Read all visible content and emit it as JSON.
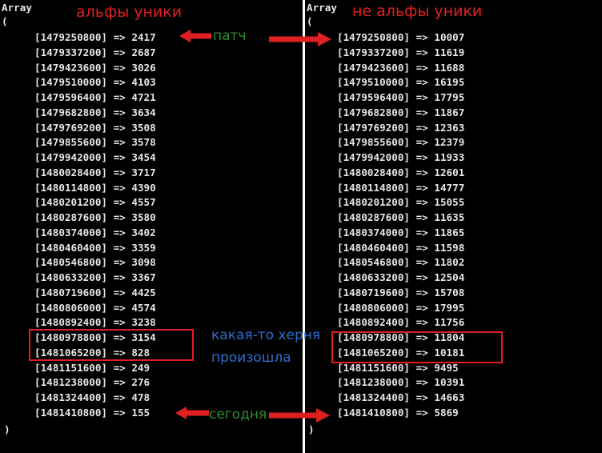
{
  "left": {
    "header": "Array",
    "open_paren": "(",
    "close_paren": ")",
    "title": "альфы уники",
    "rows": [
      {
        "key": "[1479250800]",
        "arrow": "=>",
        "value": "2417"
      },
      {
        "key": "[1479337200]",
        "arrow": "=>",
        "value": "2687"
      },
      {
        "key": "[1479423600]",
        "arrow": "=>",
        "value": "3026"
      },
      {
        "key": "[1479510000]",
        "arrow": "=>",
        "value": "4103"
      },
      {
        "key": "[1479596400]",
        "arrow": "=>",
        "value": "4721"
      },
      {
        "key": "[1479682800]",
        "arrow": "=>",
        "value": "3634"
      },
      {
        "key": "[1479769200]",
        "arrow": "=>",
        "value": "3508"
      },
      {
        "key": "[1479855600]",
        "arrow": "=>",
        "value": "3578"
      },
      {
        "key": "[1479942000]",
        "arrow": "=>",
        "value": "3454"
      },
      {
        "key": "[1480028400]",
        "arrow": "=>",
        "value": "3717"
      },
      {
        "key": "[1480114800]",
        "arrow": "=>",
        "value": "4390"
      },
      {
        "key": "[1480201200]",
        "arrow": "=>",
        "value": "4557"
      },
      {
        "key": "[1480287600]",
        "arrow": "=>",
        "value": "3580"
      },
      {
        "key": "[1480374000]",
        "arrow": "=>",
        "value": "3402"
      },
      {
        "key": "[1480460400]",
        "arrow": "=>",
        "value": "3359"
      },
      {
        "key": "[1480546800]",
        "arrow": "=>",
        "value": "3098"
      },
      {
        "key": "[1480633200]",
        "arrow": "=>",
        "value": "3367"
      },
      {
        "key": "[1480719600]",
        "arrow": "=>",
        "value": "4425"
      },
      {
        "key": "[1480806000]",
        "arrow": "=>",
        "value": "4574"
      },
      {
        "key": "[1480892400]",
        "arrow": "=>",
        "value": "3238"
      },
      {
        "key": "[1480978800]",
        "arrow": "=>",
        "value": "3154"
      },
      {
        "key": "[1481065200]",
        "arrow": "=>",
        "value": "828"
      },
      {
        "key": "[1481151600]",
        "arrow": "=>",
        "value": "249"
      },
      {
        "key": "[1481238000]",
        "arrow": "=>",
        "value": "276"
      },
      {
        "key": "[1481324400]",
        "arrow": "=>",
        "value": "478"
      },
      {
        "key": "[1481410800]",
        "arrow": "=>",
        "value": "155"
      }
    ]
  },
  "right": {
    "header": "Array",
    "open_paren": "(",
    "close_paren": ")",
    "title": "не альфы уники",
    "rows": [
      {
        "key": "[1479250800]",
        "arrow": "=>",
        "value": "10007"
      },
      {
        "key": "[1479337200]",
        "arrow": "=>",
        "value": "11619"
      },
      {
        "key": "[1479423600]",
        "arrow": "=>",
        "value": "11688"
      },
      {
        "key": "[1479510000]",
        "arrow": "=>",
        "value": "16195"
      },
      {
        "key": "[1479596400]",
        "arrow": "=>",
        "value": "17795"
      },
      {
        "key": "[1479682800]",
        "arrow": "=>",
        "value": "11867"
      },
      {
        "key": "[1479769200]",
        "arrow": "=>",
        "value": "12363"
      },
      {
        "key": "[1479855600]",
        "arrow": "=>",
        "value": "12379"
      },
      {
        "key": "[1479942000]",
        "arrow": "=>",
        "value": "11933"
      },
      {
        "key": "[1480028400]",
        "arrow": "=>",
        "value": "12601"
      },
      {
        "key": "[1480114800]",
        "arrow": "=>",
        "value": "14777"
      },
      {
        "key": "[1480201200]",
        "arrow": "=>",
        "value": "15055"
      },
      {
        "key": "[1480287600]",
        "arrow": "=>",
        "value": "11635"
      },
      {
        "key": "[1480374000]",
        "arrow": "=>",
        "value": "11865"
      },
      {
        "key": "[1480460400]",
        "arrow": "=>",
        "value": "11598"
      },
      {
        "key": "[1480546800]",
        "arrow": "=>",
        "value": "11802"
      },
      {
        "key": "[1480633200]",
        "arrow": "=>",
        "value": "12504"
      },
      {
        "key": "[1480719600]",
        "arrow": "=>",
        "value": "15708"
      },
      {
        "key": "[1480806000]",
        "arrow": "=>",
        "value": "17995"
      },
      {
        "key": "[1480892400]",
        "arrow": "=>",
        "value": "11756"
      },
      {
        "key": "[1480978800]",
        "arrow": "=>",
        "value": "11804"
      },
      {
        "key": "[1481065200]",
        "arrow": "=>",
        "value": "10181"
      },
      {
        "key": "[1481151600]",
        "arrow": "=>",
        "value": "9495"
      },
      {
        "key": "[1481238000]",
        "arrow": "=>",
        "value": "10391"
      },
      {
        "key": "[1481324400]",
        "arrow": "=>",
        "value": "14663"
      },
      {
        "key": "[1481410800]",
        "arrow": "=>",
        "value": "5869"
      }
    ]
  },
  "annotations": {
    "patch": "патч",
    "something_happened_line1": "какая-то херня",
    "something_happened_line2": "произошла",
    "today": "сегодня"
  },
  "colors": {
    "console_bg": "#000000",
    "console_text": "#e6e6e6",
    "title_red": "#e02020",
    "note_green": "#2e8b2e",
    "note_blue": "#2f6fd0",
    "box_red": "#e02020"
  }
}
